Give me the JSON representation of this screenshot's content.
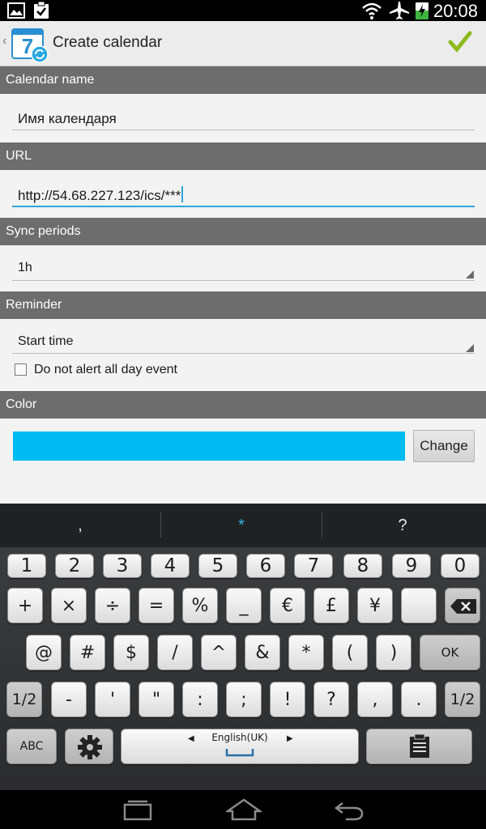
{
  "status_bar": {
    "time": "20:08",
    "icons": [
      "image-icon",
      "clipboard-check-icon",
      "wifi-icon",
      "airplane-icon",
      "battery-charging-icon"
    ]
  },
  "action_bar": {
    "title": "Create calendar",
    "app_icon": "calendar-7-sync-icon",
    "confirm_icon": "checkmark-icon",
    "colors": {
      "checkmark": "#8cba1c"
    }
  },
  "form": {
    "calendar_name": {
      "label": "Calendar name",
      "value": "Имя календаря"
    },
    "url": {
      "label": "URL",
      "value": "http://54.68.227.123/ics/***"
    },
    "sync_periods": {
      "label": "Sync periods",
      "value": "1h"
    },
    "reminder": {
      "label": "Reminder",
      "value": "Start time",
      "checkbox_label": "Do not alert all day event",
      "checkbox_checked": false
    },
    "color": {
      "label": "Color",
      "swatch": "#00bcf2",
      "change_label": "Change"
    }
  },
  "keyboard": {
    "suggestions": [
      ",",
      "*",
      "?"
    ],
    "number_row": [
      "1",
      "2",
      "3",
      "4",
      "5",
      "6",
      "7",
      "8",
      "9",
      "0"
    ],
    "row1": [
      "+",
      "×",
      "÷",
      "=",
      "%",
      "_",
      "€",
      "£",
      "¥",
      ""
    ],
    "row2": [
      "@",
      "#",
      "$",
      "/",
      "^",
      "&",
      "*",
      "(",
      ")"
    ],
    "ok_label": "OK",
    "row3_left": "1/2",
    "row3": [
      "-",
      "'",
      "\"",
      ":",
      ";",
      "!",
      "?",
      ",",
      "."
    ],
    "row3_right": "1/2",
    "abc_label": "ABC",
    "space_label": "English(UK)",
    "backspace_icon": "backspace-icon",
    "settings_icon": "gear-icon",
    "clipboard_icon": "clipboard-icon"
  },
  "nav_bar": {
    "icons": [
      "recent-apps-icon",
      "home-icon",
      "back-icon"
    ]
  }
}
